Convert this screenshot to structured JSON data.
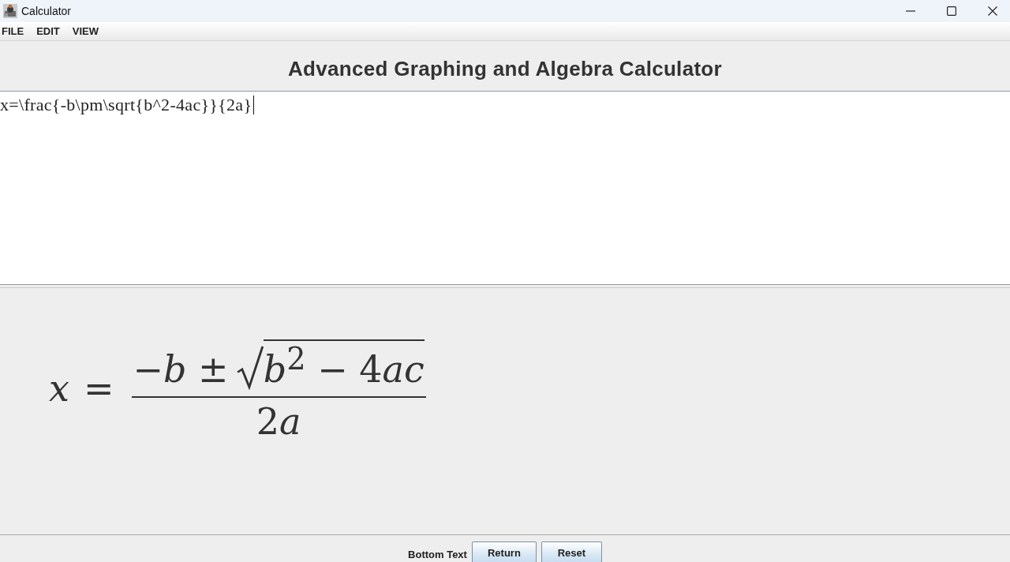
{
  "window": {
    "title": "Calculator"
  },
  "menu_bar": [
    "FILE",
    "EDIT",
    "VIEW"
  ],
  "header": {
    "title": "Advanced Graphing and Algebra Calculator"
  },
  "latex_input": {
    "value": "x=\\frac{-b\\pm\\sqrt{b^2-4ac}}{2a}",
    "focused": true
  },
  "rendered_formula": {
    "lhs": "x",
    "relation": "=",
    "numerator": "−*b* ±",
    "radicand": [
      "*b*$^{2}$ − 4",
      "*ac*"
    ],
    "denominator": [
      "2",
      "*a*"
    ]
  },
  "bottom_bar": {
    "label": "Bottom Text",
    "buttons": [
      "Return",
      "Reset"
    ]
  }
}
